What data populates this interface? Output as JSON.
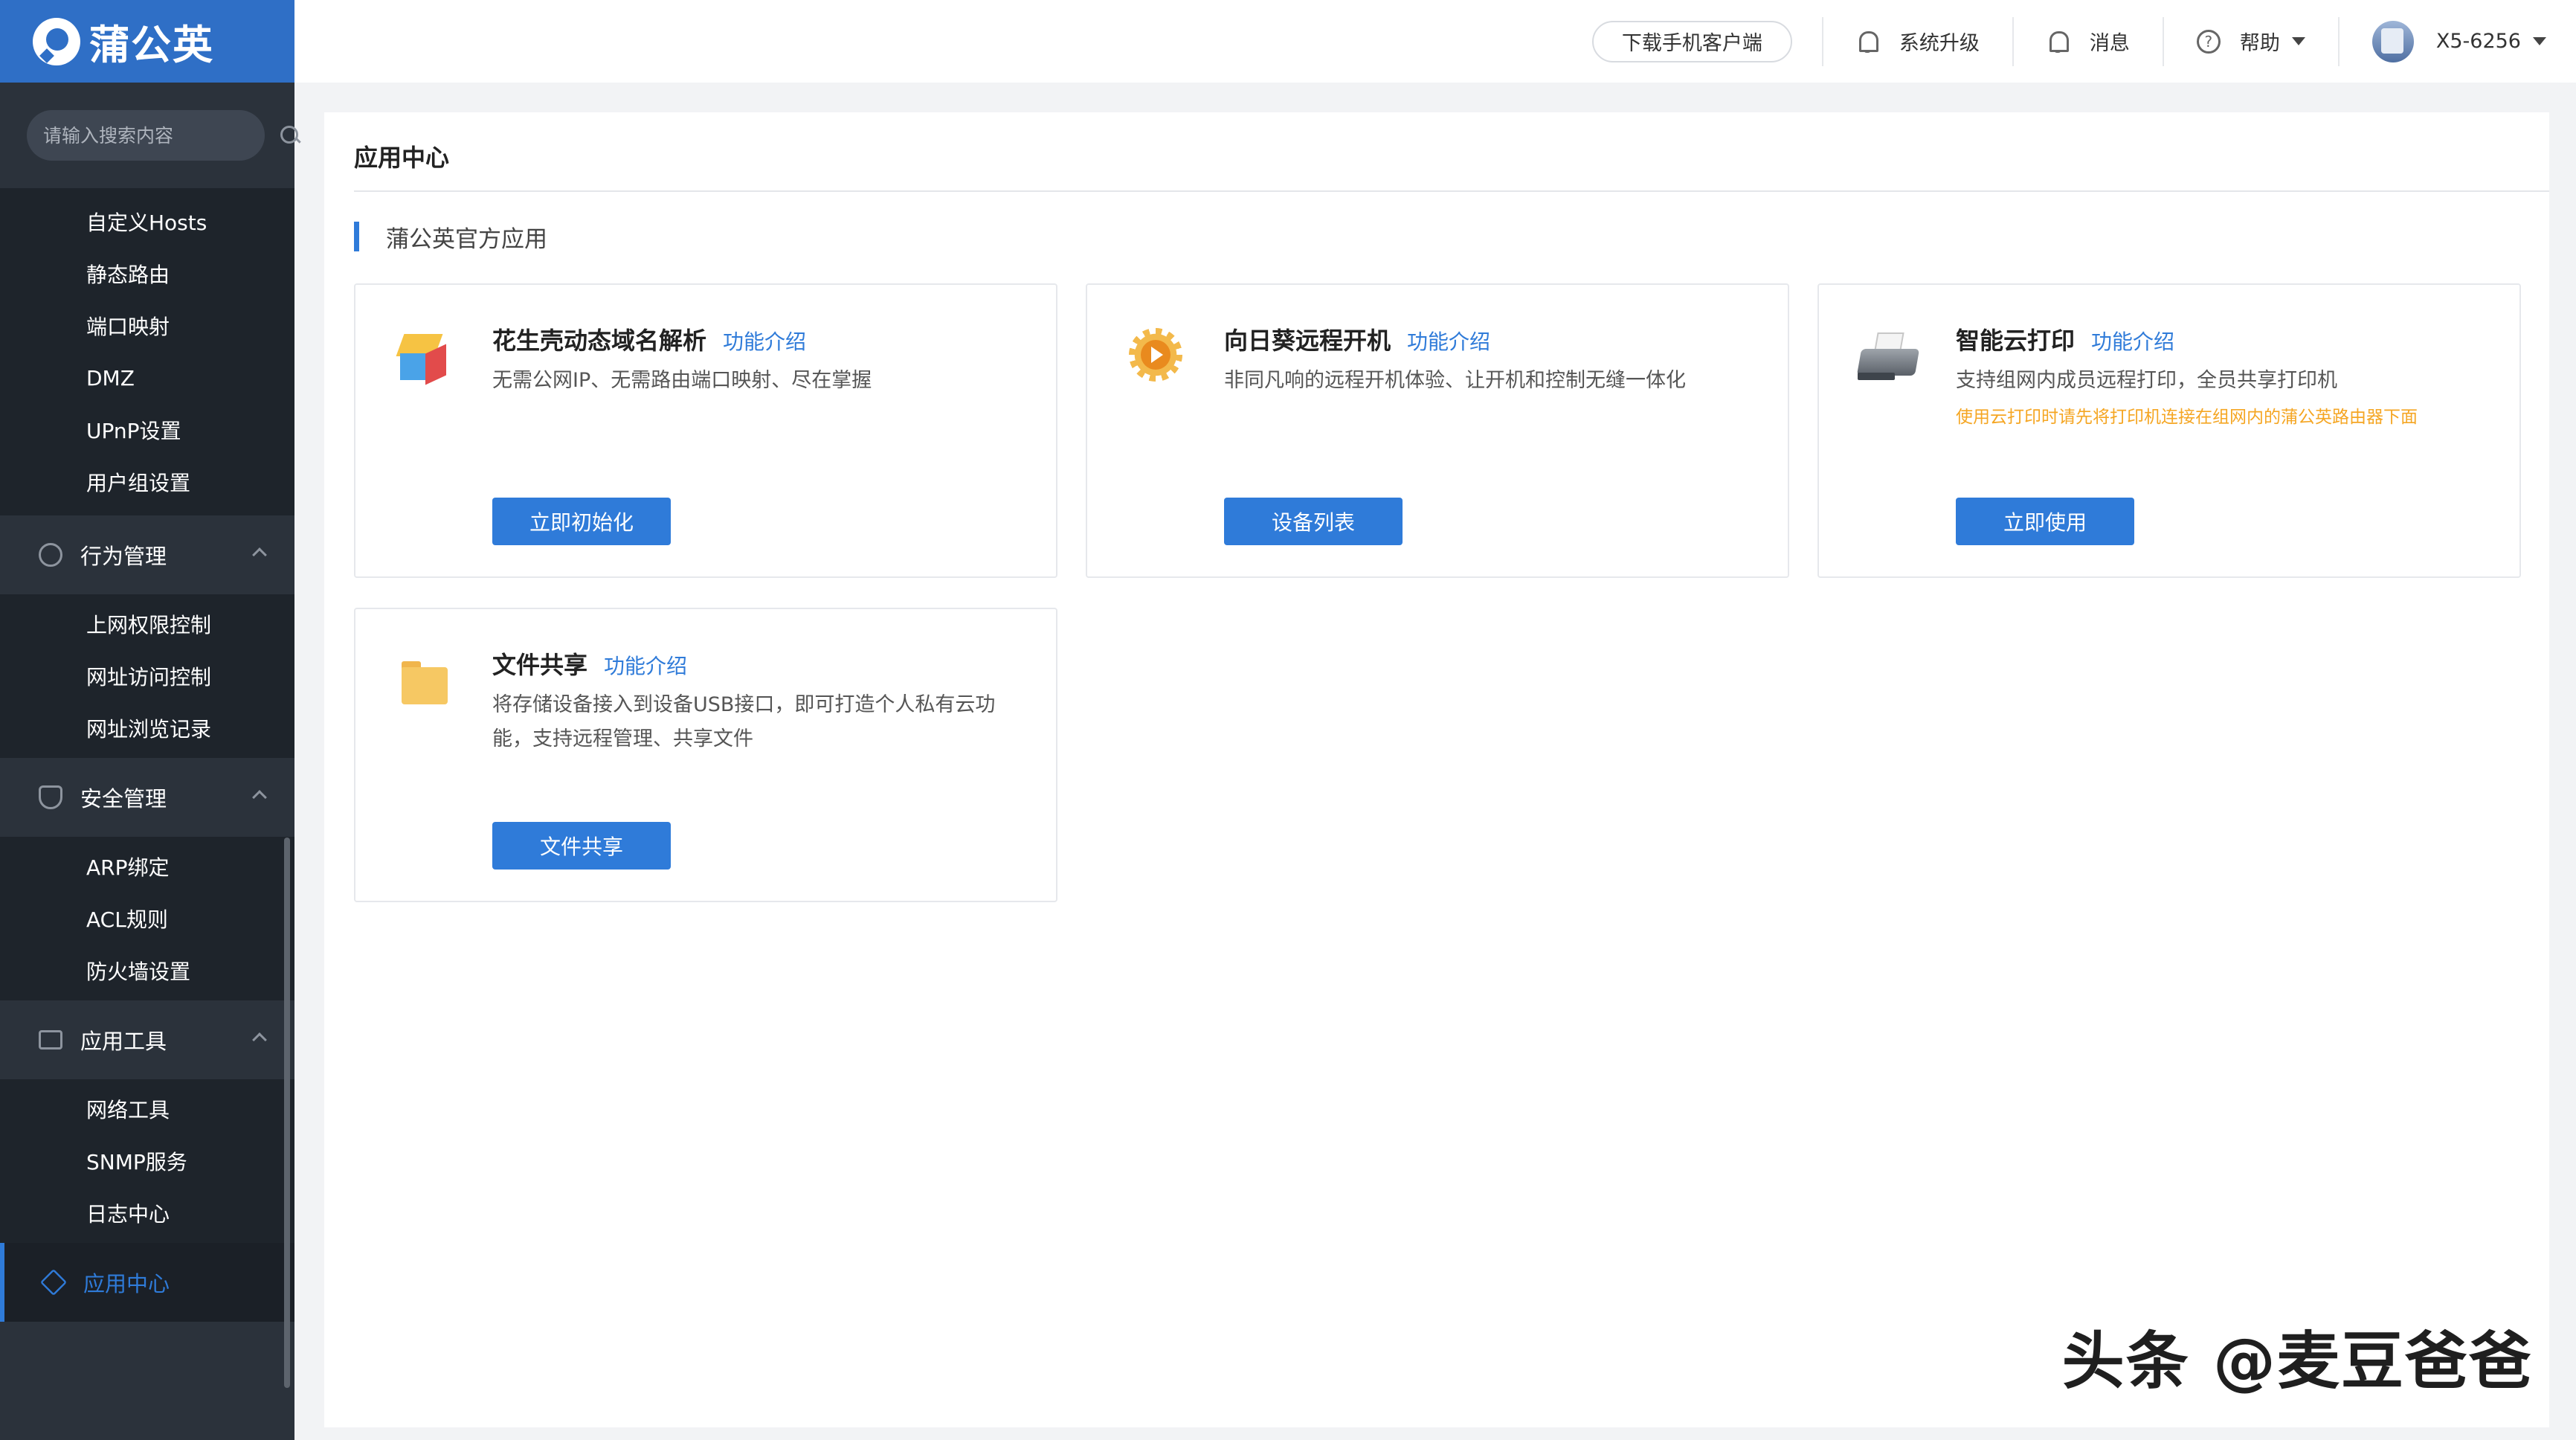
{
  "brand": {
    "name": "蒲公英",
    "color": "#2f6fc6"
  },
  "sidebar": {
    "search_placeholder": "请输入搜索内容",
    "top_items": [
      {
        "label": "自定义Hosts"
      },
      {
        "label": "静态路由"
      },
      {
        "label": "端口映射"
      },
      {
        "label": "DMZ"
      },
      {
        "label": "UPnP设置"
      },
      {
        "label": "用户组设置"
      }
    ],
    "groups": [
      {
        "label": "行为管理",
        "icon": "eye-icon",
        "items": [
          "上网权限控制",
          "网址访问控制",
          "网址浏览记录"
        ]
      },
      {
        "label": "安全管理",
        "icon": "shield-icon",
        "items": [
          "ARP绑定",
          "ACL规则",
          "防火墙设置"
        ]
      },
      {
        "label": "应用工具",
        "icon": "toolbox-icon",
        "items": [
          "网络工具",
          "SNMP服务",
          "日志中心"
        ]
      }
    ],
    "active": {
      "label": "应用中心",
      "icon": "cube-icon"
    }
  },
  "header": {
    "download": "下载手机客户端",
    "upgrade": "系统升级",
    "messages": "消息",
    "help": "帮助",
    "device": "X5-6256"
  },
  "main": {
    "title": "应用中心",
    "section": "蒲公英官方应用",
    "link_label": "功能介绍",
    "apps": [
      {
        "name": "花生壳动态域名解析",
        "desc": "无需公网IP、无需路由端口映射、尽在掌握",
        "note": "",
        "button": "立即初始化",
        "icon": "cube-colored-icon"
      },
      {
        "name": "向日葵远程开机",
        "desc": "非同凡响的远程开机体验、让开机和控制无缝一体化",
        "note": "",
        "button": "设备列表",
        "icon": "sunflower-icon"
      },
      {
        "name": "智能云打印",
        "desc": "支持组网内成员远程打印，全员共享打印机",
        "note": "使用云打印时请先将打印机连接在组网内的蒲公英路由器下面",
        "button": "立即使用",
        "icon": "printer-icon"
      },
      {
        "name": "文件共享",
        "desc": "将存储设备接入到设备USB接口，即可打造个人私有云功能，支持远程管理、共享文件",
        "note": "",
        "button": "文件共享",
        "icon": "folder-icon"
      }
    ]
  },
  "watermark": "头条 @麦豆爸爸",
  "colors": {
    "accent": "#2f7bd9",
    "sidebar_bg": "#2b323b",
    "sidebar_sub_bg": "#1e242b",
    "note": "#f5a623"
  }
}
